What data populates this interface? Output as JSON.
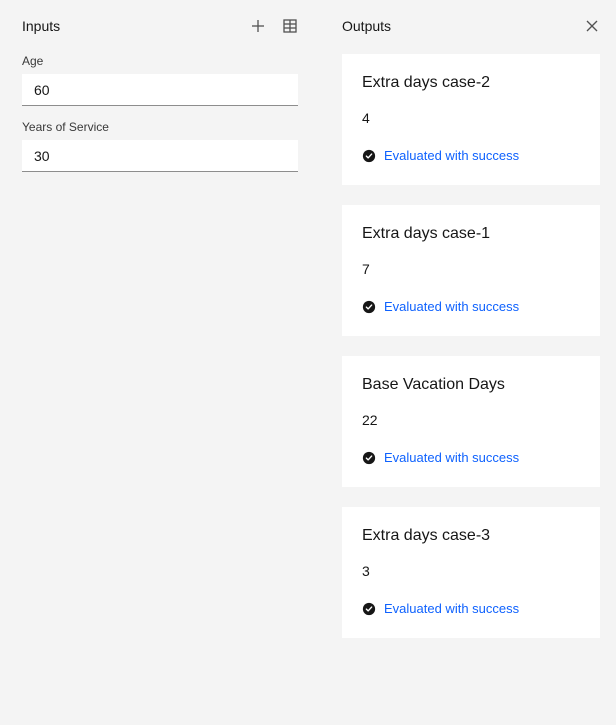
{
  "inputs": {
    "title": "Inputs",
    "fields": [
      {
        "label": "Age",
        "value": "60"
      },
      {
        "label": "Years of Service",
        "value": "30"
      }
    ]
  },
  "outputs": {
    "title": "Outputs",
    "items": [
      {
        "title": "Extra days case-2",
        "value": "4",
        "status": "Evaluated with success"
      },
      {
        "title": "Extra days case-1",
        "value": "7",
        "status": "Evaluated with success"
      },
      {
        "title": "Base Vacation Days",
        "value": "22",
        "status": "Evaluated with success"
      },
      {
        "title": "Extra days case-3",
        "value": "3",
        "status": "Evaluated with success"
      }
    ]
  }
}
